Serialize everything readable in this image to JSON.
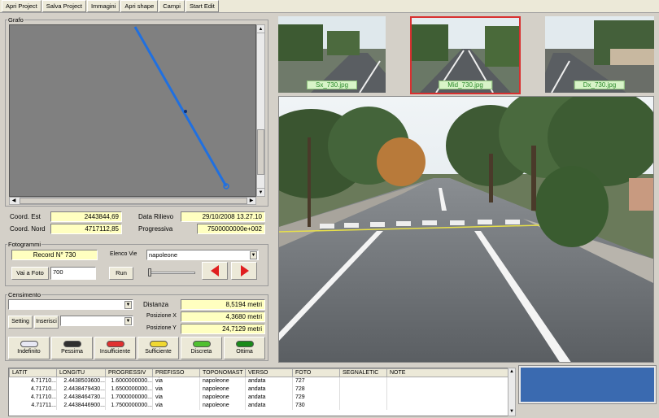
{
  "toolbar": {
    "items": [
      "Apri Project",
      "Salva Project",
      "Immagini",
      "Apri shape",
      "Campi",
      "Start Edit"
    ]
  },
  "grafo": {
    "title": "Grafo"
  },
  "coords": {
    "est_label": "Coord. Est",
    "est_value": "2443844,69",
    "nord_label": "Coord. Nord",
    "nord_value": "4717112,85",
    "data_label": "Data Rilievo",
    "data_value": "29/10/2008 13.27.10",
    "prog_label": "Progressiva",
    "prog_value": "7500000000e+002"
  },
  "fotogrammi": {
    "title": "Fotogrammi",
    "record": "Record N° 730",
    "elenco_label": "Elenco Vie",
    "elenco_value": "napoleone",
    "vai_label": "Vai a Foto",
    "vai_value": "700",
    "run_label": "Run"
  },
  "censimento": {
    "title": "Censimento",
    "setting_label": "Setting",
    "inserisci_label": "Inserisci",
    "distanza_label": "Distanza",
    "distanza_value": "8,5194 metri",
    "posx_label": "Posizione X",
    "posx_value": "4,3680 metri",
    "posy_label": "Posizione Y",
    "posy_value": "24,7129 metri",
    "ratings": [
      {
        "label": "Indefinito",
        "color": "#e8e8f4"
      },
      {
        "label": "Pessima",
        "color": "#303030"
      },
      {
        "label": "Insufficiente",
        "color": "#e03030"
      },
      {
        "label": "Sufficiente",
        "color": "#f0d830"
      },
      {
        "label": "Discreta",
        "color": "#50c030"
      },
      {
        "label": "Ottima",
        "color": "#1a8a1a"
      }
    ]
  },
  "thumbs": {
    "sx": "Sx_730.jpg",
    "mid": "Mid_730.jpg",
    "dx": "Dx_730.jpg"
  },
  "table": {
    "headers": [
      "LATIT",
      "LONGITU",
      "PROGRESSIV",
      "PREFISSO",
      "TOPONOMAST",
      "VERSO",
      "FOTO",
      "SEGNALETIC",
      "NOTE"
    ],
    "rows": [
      [
        "4.71710...",
        "2.4438503600...",
        "1.6000000000...",
        "via",
        "napoleone",
        "andata",
        "727",
        "",
        ""
      ],
      [
        "4.71710...",
        "2.4438479430...",
        "1.6500000000...",
        "via",
        "napoleone",
        "andata",
        "728",
        "",
        ""
      ],
      [
        "4.71710...",
        "2.4438464730...",
        "1.7000000000...",
        "via",
        "napoleone",
        "andata",
        "729",
        "",
        ""
      ],
      [
        "4.71711...",
        "2.4438446900...",
        "1.7500000000...",
        "via",
        "napoleone",
        "andata",
        "730",
        "",
        ""
      ]
    ]
  },
  "colors": {
    "accent_blue": "#3a6ab0",
    "yellow_field": "#ffffc0",
    "selected_frame": "#d83030"
  }
}
